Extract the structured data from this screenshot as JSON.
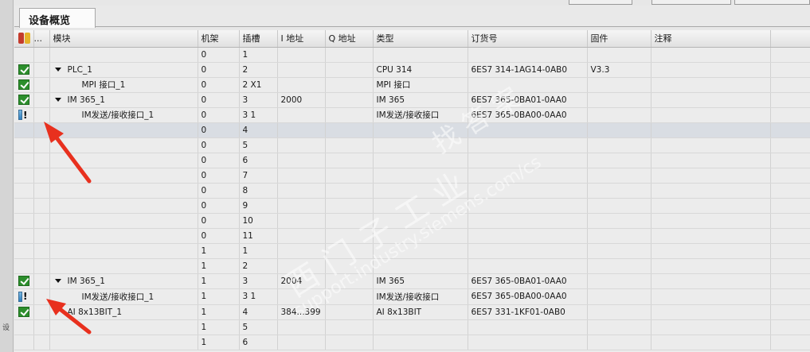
{
  "tab": {
    "label": "设备概览"
  },
  "left_strip_text": "设",
  "columns": {
    "status": "",
    "dots": "...",
    "module": "模块",
    "rack": "机架",
    "slot": "插槽",
    "i_addr": "I 地址",
    "q_addr": "Q 地址",
    "type": "类型",
    "order": "订货号",
    "firmware": "固件",
    "comment": "注释"
  },
  "rows": [
    {
      "status": "",
      "module": "",
      "level": 0,
      "expand": false,
      "rack": "0",
      "slot": "1",
      "i": "",
      "q": "",
      "type": "",
      "order": "",
      "fw": ""
    },
    {
      "status": "ok",
      "module": "PLC_1",
      "level": 1,
      "expand": true,
      "rack": "0",
      "slot": "2",
      "i": "",
      "q": "",
      "type": "CPU 314",
      "order": "6ES7 314-1AG14-0AB0",
      "fw": "V3.3"
    },
    {
      "status": "ok",
      "module": "MPI 接口_1",
      "level": 2,
      "expand": false,
      "rack": "0",
      "slot": "2 X1",
      "i": "",
      "q": "",
      "type": "MPI 接口",
      "order": "",
      "fw": ""
    },
    {
      "status": "ok",
      "module": "IM 365_1",
      "level": 1,
      "expand": true,
      "rack": "0",
      "slot": "3",
      "i": "2000",
      "q": "",
      "type": "IM 365",
      "order": "6ES7 365-0BA01-0AA0",
      "fw": ""
    },
    {
      "status": "warn",
      "module": "IM发送/接收接口_1",
      "level": 2,
      "expand": false,
      "rack": "0",
      "slot": "3 1",
      "i": "",
      "q": "",
      "type": "IM发送/接收接口",
      "order": "6ES7 365-0BA00-0AA0",
      "fw": ""
    },
    {
      "status": "",
      "module": "",
      "level": 0,
      "expand": false,
      "rack": "0",
      "slot": "4",
      "i": "",
      "q": "",
      "type": "",
      "order": "",
      "fw": "",
      "selected": true
    },
    {
      "status": "",
      "module": "",
      "level": 0,
      "expand": false,
      "rack": "0",
      "slot": "5",
      "i": "",
      "q": "",
      "type": "",
      "order": "",
      "fw": ""
    },
    {
      "status": "",
      "module": "",
      "level": 0,
      "expand": false,
      "rack": "0",
      "slot": "6",
      "i": "",
      "q": "",
      "type": "",
      "order": "",
      "fw": ""
    },
    {
      "status": "",
      "module": "",
      "level": 0,
      "expand": false,
      "rack": "0",
      "slot": "7",
      "i": "",
      "q": "",
      "type": "",
      "order": "",
      "fw": ""
    },
    {
      "status": "",
      "module": "",
      "level": 0,
      "expand": false,
      "rack": "0",
      "slot": "8",
      "i": "",
      "q": "",
      "type": "",
      "order": "",
      "fw": ""
    },
    {
      "status": "",
      "module": "",
      "level": 0,
      "expand": false,
      "rack": "0",
      "slot": "9",
      "i": "",
      "q": "",
      "type": "",
      "order": "",
      "fw": ""
    },
    {
      "status": "",
      "module": "",
      "level": 0,
      "expand": false,
      "rack": "0",
      "slot": "10",
      "i": "",
      "q": "",
      "type": "",
      "order": "",
      "fw": ""
    },
    {
      "status": "",
      "module": "",
      "level": 0,
      "expand": false,
      "rack": "0",
      "slot": "11",
      "i": "",
      "q": "",
      "type": "",
      "order": "",
      "fw": ""
    },
    {
      "status": "",
      "module": "",
      "level": 0,
      "expand": false,
      "rack": "1",
      "slot": "1",
      "i": "",
      "q": "",
      "type": "",
      "order": "",
      "fw": ""
    },
    {
      "status": "",
      "module": "",
      "level": 0,
      "expand": false,
      "rack": "1",
      "slot": "2",
      "i": "",
      "q": "",
      "type": "",
      "order": "",
      "fw": ""
    },
    {
      "status": "ok",
      "module": "IM 365_1",
      "level": 1,
      "expand": true,
      "rack": "1",
      "slot": "3",
      "i": "2004",
      "q": "",
      "type": "IM 365",
      "order": "6ES7 365-0BA01-0AA0",
      "fw": ""
    },
    {
      "status": "warn",
      "module": "IM发送/接收接口_1",
      "level": 2,
      "expand": false,
      "rack": "1",
      "slot": "3 1",
      "i": "",
      "q": "",
      "type": "IM发送/接收接口",
      "order": "6ES7 365-0BA00-0AA0",
      "fw": ""
    },
    {
      "status": "ok",
      "module": "AI 8x13BIT_1",
      "level": 1,
      "expand": false,
      "rack": "1",
      "slot": "4",
      "i": "384...399",
      "q": "",
      "type": "AI 8x13BIT",
      "order": "6ES7 331-1KF01-0AB0",
      "fw": ""
    },
    {
      "status": "",
      "module": "",
      "level": 0,
      "expand": false,
      "rack": "1",
      "slot": "5",
      "i": "",
      "q": "",
      "type": "",
      "order": "",
      "fw": ""
    },
    {
      "status": "",
      "module": "",
      "level": 0,
      "expand": false,
      "rack": "1",
      "slot": "6",
      "i": "",
      "q": "",
      "type": "",
      "order": "",
      "fw": ""
    }
  ],
  "watermark": {
    "cn": "西门子工业",
    "url": "support.industry.siemens.com/cs",
    "cn2": "找答案"
  },
  "colors": {
    "ok": "#2c8e2c",
    "warn": "#2e7fbf",
    "arrow": "#e8301e",
    "selected_row": "#d9dde3"
  }
}
